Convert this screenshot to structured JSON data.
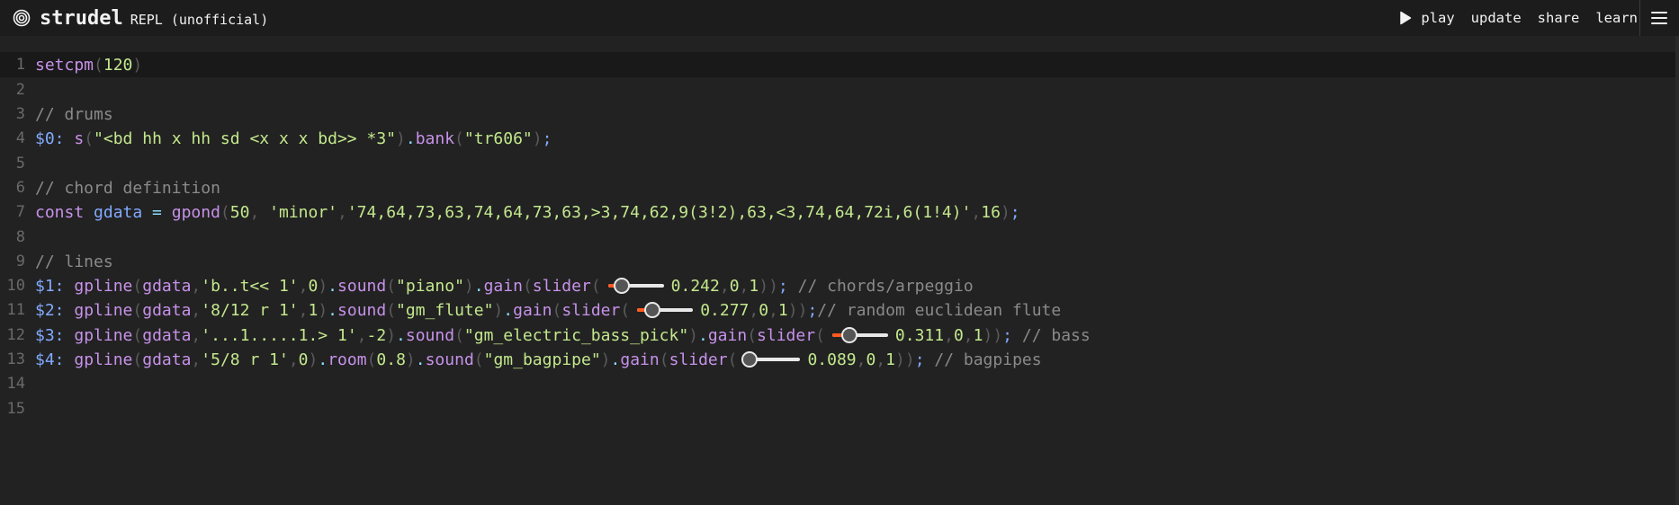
{
  "header": {
    "brand": "strudel",
    "subtitle": "REPL (unofficial)",
    "actions": {
      "play": "play",
      "update": "update",
      "share": "share",
      "learn": "learn"
    },
    "icons": {
      "logo": "spiral-logo-icon",
      "play": "play-icon",
      "menu": "hamburger-menu-icon"
    }
  },
  "editor": {
    "line_numbers": [
      "1",
      "2",
      "3",
      "4",
      "5",
      "6",
      "7",
      "8",
      "9",
      "10",
      "11",
      "12",
      "13",
      "14",
      "15"
    ],
    "active_line": 1,
    "sliders": [
      {
        "label": "0.242",
        "value": 0.242,
        "min": 0,
        "max": 1
      },
      {
        "label": "0.277",
        "value": 0.277,
        "min": 0,
        "max": 1
      },
      {
        "label": "0.311",
        "value": 0.311,
        "min": 0,
        "max": 1
      },
      {
        "label": "0.089",
        "value": 0.089,
        "min": 0,
        "max": 1
      }
    ],
    "lines": [
      [
        [
          "fn",
          "setcpm"
        ],
        [
          "pun",
          "("
        ],
        [
          "num",
          "120"
        ],
        [
          "pun",
          ")"
        ]
      ],
      [],
      [
        [
          "cmt",
          "// drums"
        ]
      ],
      [
        [
          "lbl",
          "$0: "
        ],
        [
          "fn",
          "s"
        ],
        [
          "pun",
          "("
        ],
        [
          "str",
          "\"<bd hh x hh sd <x x x bd>> *3\""
        ],
        [
          "pun",
          ")"
        ],
        [
          "dot",
          "."
        ],
        [
          "fn",
          "bank"
        ],
        [
          "pun",
          "("
        ],
        [
          "str",
          "\"tr606\""
        ],
        [
          "pun",
          ")"
        ],
        [
          "semi",
          ";"
        ]
      ],
      [],
      [
        [
          "cmt",
          "// chord definition"
        ]
      ],
      [
        [
          "kw",
          "const "
        ],
        [
          "var",
          "gdata"
        ],
        [
          "op",
          " = "
        ],
        [
          "fn",
          "gpond"
        ],
        [
          "pun",
          "("
        ],
        [
          "num",
          "50"
        ],
        [
          "pun",
          ", "
        ],
        [
          "str",
          "'minor'"
        ],
        [
          "pun",
          ","
        ],
        [
          "str",
          "'74,64,73,63,74,64,73,63,>3,74,62,9(3!2),63,<3,74,64,72i,6(1!4)'"
        ],
        [
          "pun",
          ","
        ],
        [
          "num",
          "16"
        ],
        [
          "pun",
          ")"
        ],
        [
          "semi",
          ";"
        ]
      ],
      [],
      [
        [
          "cmt",
          "// lines"
        ]
      ],
      [
        [
          "lbl",
          "$1: "
        ],
        [
          "fn",
          "gpline"
        ],
        [
          "pun",
          "("
        ],
        [
          "fn",
          "gdata"
        ],
        [
          "pun",
          ","
        ],
        [
          "str",
          "'b..t<< 1'"
        ],
        [
          "pun",
          ","
        ],
        [
          "num",
          "0"
        ],
        [
          "pun",
          ")"
        ],
        [
          "dot",
          "."
        ],
        [
          "fn",
          "sound"
        ],
        [
          "pun",
          "("
        ],
        [
          "str",
          "\"piano\""
        ],
        [
          "pun",
          ")"
        ],
        [
          "dot",
          "."
        ],
        [
          "fn",
          "gain"
        ],
        [
          "pun",
          "("
        ],
        [
          "fn",
          "slider"
        ],
        [
          "pun",
          "("
        ],
        [
          "slider",
          "0"
        ],
        [
          "num",
          "0.242"
        ],
        [
          "pun",
          ","
        ],
        [
          "num",
          "0"
        ],
        [
          "pun",
          ","
        ],
        [
          "num",
          "1"
        ],
        [
          "pun",
          "))"
        ],
        [
          "semi",
          "; "
        ],
        [
          "cmt",
          "// chords/arpeggio"
        ]
      ],
      [
        [
          "lbl",
          "$2: "
        ],
        [
          "fn",
          "gpline"
        ],
        [
          "pun",
          "("
        ],
        [
          "fn",
          "gdata"
        ],
        [
          "pun",
          ","
        ],
        [
          "str",
          "'8/12 r 1'"
        ],
        [
          "pun",
          ","
        ],
        [
          "num",
          "1"
        ],
        [
          "pun",
          ")"
        ],
        [
          "dot",
          "."
        ],
        [
          "fn",
          "sound"
        ],
        [
          "pun",
          "("
        ],
        [
          "str",
          "\"gm_flute\""
        ],
        [
          "pun",
          ")"
        ],
        [
          "dot",
          "."
        ],
        [
          "fn",
          "gain"
        ],
        [
          "pun",
          "("
        ],
        [
          "fn",
          "slider"
        ],
        [
          "pun",
          "("
        ],
        [
          "slider",
          "1"
        ],
        [
          "num",
          "0.277"
        ],
        [
          "pun",
          ","
        ],
        [
          "num",
          "0"
        ],
        [
          "pun",
          ","
        ],
        [
          "num",
          "1"
        ],
        [
          "pun",
          "))"
        ],
        [
          "semi",
          ";"
        ],
        [
          "cmt",
          "// random euclidean flute"
        ]
      ],
      [
        [
          "lbl",
          "$3: "
        ],
        [
          "fn",
          "gpline"
        ],
        [
          "pun",
          "("
        ],
        [
          "fn",
          "gdata"
        ],
        [
          "pun",
          ","
        ],
        [
          "str",
          "'...1.....1.> 1'"
        ],
        [
          "pun",
          ","
        ],
        [
          "num",
          "-2"
        ],
        [
          "pun",
          ")"
        ],
        [
          "dot",
          "."
        ],
        [
          "fn",
          "sound"
        ],
        [
          "pun",
          "("
        ],
        [
          "str",
          "\"gm_electric_bass_pick\""
        ],
        [
          "pun",
          ")"
        ],
        [
          "dot",
          "."
        ],
        [
          "fn",
          "gain"
        ],
        [
          "pun",
          "("
        ],
        [
          "fn",
          "slider"
        ],
        [
          "pun",
          "("
        ],
        [
          "slider",
          "2"
        ],
        [
          "num",
          "0.311"
        ],
        [
          "pun",
          ","
        ],
        [
          "num",
          "0"
        ],
        [
          "pun",
          ","
        ],
        [
          "num",
          "1"
        ],
        [
          "pun",
          "))"
        ],
        [
          "semi",
          "; "
        ],
        [
          "cmt",
          "// bass"
        ]
      ],
      [
        [
          "lbl",
          "$4: "
        ],
        [
          "fn",
          "gpline"
        ],
        [
          "pun",
          "("
        ],
        [
          "fn",
          "gdata"
        ],
        [
          "pun",
          ","
        ],
        [
          "str",
          "'5/8 r 1'"
        ],
        [
          "pun",
          ","
        ],
        [
          "num",
          "0"
        ],
        [
          "pun",
          ")"
        ],
        [
          "dot",
          "."
        ],
        [
          "fn",
          "room"
        ],
        [
          "pun",
          "("
        ],
        [
          "num",
          "0.8"
        ],
        [
          "pun",
          ")"
        ],
        [
          "dot",
          "."
        ],
        [
          "fn",
          "sound"
        ],
        [
          "pun",
          "("
        ],
        [
          "str",
          "\"gm_bagpipe\""
        ],
        [
          "pun",
          ")"
        ],
        [
          "dot",
          "."
        ],
        [
          "fn",
          "gain"
        ],
        [
          "pun",
          "("
        ],
        [
          "fn",
          "slider"
        ],
        [
          "pun",
          "("
        ],
        [
          "slider",
          "3"
        ],
        [
          "num",
          "0.089"
        ],
        [
          "pun",
          ","
        ],
        [
          "num",
          "0"
        ],
        [
          "pun",
          ","
        ],
        [
          "num",
          "1"
        ],
        [
          "pun",
          "))"
        ],
        [
          "semi",
          "; "
        ],
        [
          "cmt",
          "// bagpipes"
        ]
      ],
      [],
      []
    ]
  }
}
